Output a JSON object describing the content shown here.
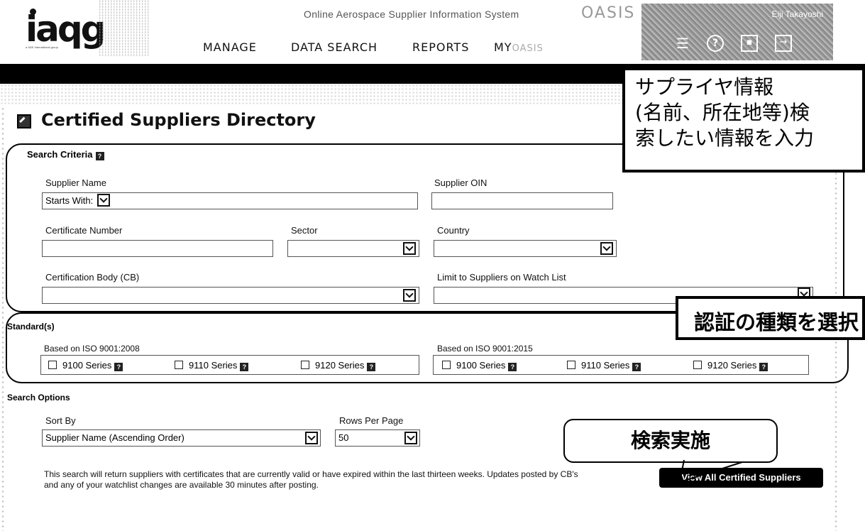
{
  "header": {
    "logo_text": "iaqg",
    "logo_subtext": "a SAE International group",
    "system_title": "Online Aerospace Supplier Information System",
    "system_acronym": "OASIS",
    "nav": {
      "manage": "MANAGE",
      "data_search": "DATA SEARCH",
      "reports": "REPORTS",
      "my_prefix": "MY",
      "my_suffix": "OASIS"
    },
    "user_name": "Eiji Takayoshi",
    "icons": [
      "menu-icon",
      "help-icon",
      "profile-icon",
      "logout-icon"
    ]
  },
  "page": {
    "title": "Certified Suppliers Directory"
  },
  "search_criteria": {
    "title": "Search Criteria",
    "supplier_name_label": "Supplier Name",
    "supplier_name_mode": "Starts With:",
    "supplier_name_value": "",
    "supplier_oin_label": "Supplier OIN",
    "supplier_oin_value": "",
    "certificate_number_label": "Certificate Number",
    "certificate_number_value": "",
    "sector_label": "Sector",
    "sector_value": "",
    "country_label": "Country",
    "country_value": "",
    "cb_label": "Certification Body (CB)",
    "cb_value": "",
    "watchlist_label": "Limit to Suppliers on Watch List",
    "watchlist_value": ""
  },
  "standards": {
    "title": "Standard(s)",
    "group_2008_label": "Based on ISO 9001:2008",
    "group_2015_label": "Based on ISO 9001:2015",
    "series_9100": "9100 Series",
    "series_9110": "9110 Series",
    "series_9120": "9120 Series"
  },
  "search_options": {
    "title": "Search Options",
    "sort_by_label": "Sort By",
    "sort_by_value": "Supplier Name (Ascending Order)",
    "rows_per_page_label": "Rows Per Page",
    "rows_per_page_value": "50"
  },
  "note": "This search will return suppliers with certificates that are currently valid or have expired within the last thirteen weeks. Updates posted by CB's and any of your watchlist changes are available 30 minutes after posting.",
  "view_button": "View All Certified Suppliers",
  "annotations": {
    "callout1_line1": "サプライヤ情報",
    "callout1_line2": "(名前、所在地等)検",
    "callout1_line3": "索したい情報を入力",
    "callout2": "認証の種類を選択",
    "callout3": "検索実施"
  },
  "colors": {
    "header_bar": "#000000",
    "button_bg": "#000000",
    "nav_text": "#111111"
  }
}
